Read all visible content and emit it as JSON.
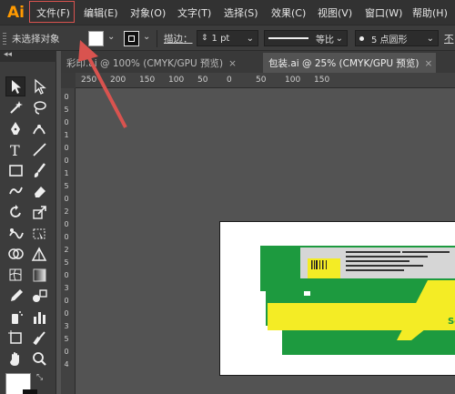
{
  "menubar": {
    "logo": "Ai",
    "items": [
      "文件(F)",
      "编辑(E)",
      "对象(O)",
      "文字(T)",
      "选择(S)",
      "效果(C)",
      "视图(V)",
      "窗口(W)",
      "帮助(H)"
    ]
  },
  "controlbar": {
    "selection_status": "未选择对象",
    "stroke_label": "描边：",
    "stroke_weight": "1 pt",
    "profile_label": "等比",
    "brush_label": "5 点圆形",
    "opacity_label": "不"
  },
  "tabs": [
    {
      "label": "彩印.ai @ 100% (CMYK/GPU 预览)",
      "close": "×"
    },
    {
      "label": "包装.ai @ 25% (CMYK/GPU 预览)",
      "close": "×"
    }
  ],
  "ruler": {
    "h_ticks": [
      "250",
      "200",
      "150",
      "100",
      "50",
      "0",
      "50",
      "100",
      "150"
    ],
    "v_ticks": [
      "0",
      "5",
      "0",
      "1",
      "0",
      "0",
      "1",
      "5",
      "0",
      "2",
      "0",
      "0",
      "2",
      "5",
      "0",
      "3",
      "0",
      "0",
      "3",
      "5",
      "0",
      "4"
    ]
  },
  "artboard": {
    "logo_fragment": "Se"
  },
  "colors": {
    "accent_orange": "#ff9a00",
    "highlight_red": "#d9534f",
    "pack_green": "#1d9a3f",
    "pack_yellow": "#f4ec25"
  },
  "icons": [
    "selection-tool-icon",
    "direct-selection-tool-icon",
    "magic-wand-icon",
    "lasso-icon",
    "pen-icon",
    "curvature-icon",
    "type-icon",
    "line-icon",
    "rectangle-icon",
    "paintbrush-icon",
    "shaper-icon",
    "eraser-icon",
    "rotate-icon",
    "scale-icon",
    "warp-icon",
    "free-transform-icon",
    "shape-builder-icon",
    "perspective-icon",
    "mesh-icon",
    "gradient-icon",
    "eyedropper-icon",
    "blend-icon",
    "symbol-sprayer-icon",
    "column-graph-icon",
    "artboard-icon",
    "slice-icon",
    "hand-icon",
    "zoom-icon"
  ]
}
